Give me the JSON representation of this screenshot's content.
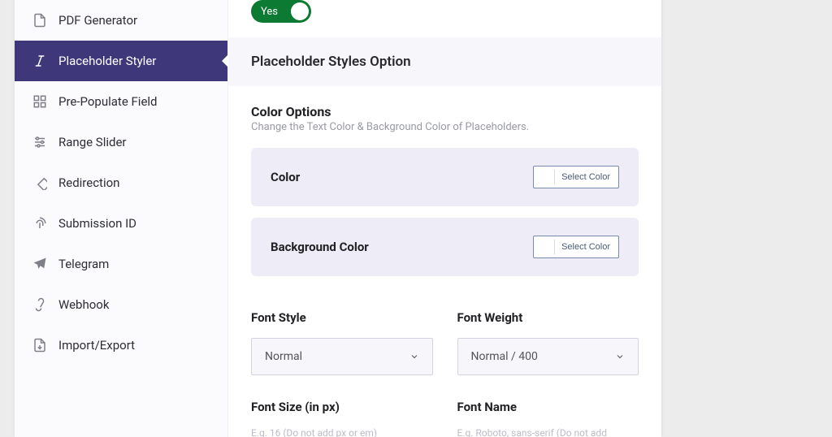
{
  "sidebar": {
    "items": [
      {
        "label": "PDF Generator"
      },
      {
        "label": "Placeholder Styler"
      },
      {
        "label": "Pre-Populate Field"
      },
      {
        "label": "Range Slider"
      },
      {
        "label": "Redirection"
      },
      {
        "label": "Submission ID"
      },
      {
        "label": "Telegram"
      },
      {
        "label": "Webhook"
      },
      {
        "label": "Import/Export"
      }
    ]
  },
  "toggle": {
    "label": "Yes",
    "state": "on"
  },
  "section_title": "Placeholder Styles Option",
  "color_group": {
    "title": "Color Options",
    "subtitle": "Change the Text Color & Background Color of Placeholders.",
    "rows": [
      {
        "label": "Color",
        "button": "Select Color"
      },
      {
        "label": "Background Color",
        "button": "Select Color"
      }
    ]
  },
  "fields": {
    "font_style": {
      "label": "Font Style",
      "value": "Normal"
    },
    "font_weight": {
      "label": "Font Weight",
      "value": "Normal / 400"
    },
    "font_size": {
      "label": "Font Size (in px)",
      "hint": "E.g. 16 (Do not add px or em)"
    },
    "font_name": {
      "label": "Font Name",
      "hint": "E.g. Roboto, sans-serif (Do not add"
    }
  }
}
